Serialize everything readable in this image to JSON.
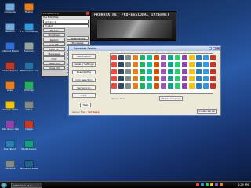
{
  "desktop_icons": [
    {
      "label": "Computer",
      "color": "#6fa8dc"
    },
    {
      "label": "Network",
      "color": "#6fa8dc"
    },
    {
      "label": "Internet Explorer",
      "color": "#2f6fd6"
    },
    {
      "label": "Adobe Reader 9",
      "color": "#c0392b"
    },
    {
      "label": "Avast",
      "color": "#e67e22"
    },
    {
      "label": "Hotmail 100%",
      "color": "#f1c40f"
    },
    {
      "label": "Dan Glove Calender",
      "color": "#8e44ad"
    },
    {
      "label": "EasyTouch",
      "color": "#2980b9"
    },
    {
      "label": "HD-Work",
      "color": "#7f8c8d"
    },
    {
      "label": "Firefox",
      "color": "#e67e22"
    },
    {
      "label": "FTP Photoshop",
      "color": "#3498db"
    },
    {
      "label": "Scanner",
      "color": "#95a5a6"
    },
    {
      "label": "HP Solution Center",
      "color": "#2471a3"
    },
    {
      "label": "Hotmail",
      "color": "#27ae60"
    },
    {
      "label": "Setup",
      "color": "#7f8c8d"
    },
    {
      "label": "Opera",
      "color": "#c0392b"
    },
    {
      "label": "Media Player",
      "color": "#16a085"
    },
    {
      "label": "Nokia PC Suite",
      "color": "#1f618d"
    }
  ],
  "prohack": {
    "title": "ProHack v1.0",
    "menu": "File  Edit  Help",
    "ip": "127.0.0.1",
    "language": "English",
    "buttons": [
      "PC Info",
      "Shutdown",
      "Restart",
      "Log Off",
      "Lock PC",
      "Messages",
      "Cmd",
      "Open CD",
      "Close CD",
      "Mouse",
      "Desktop",
      "Keyboard"
    ],
    "buttons2": [
      "Applications",
      "Processes",
      "Registry",
      "Files",
      "Screen",
      "Chat",
      "Folder",
      "Hack"
    ]
  },
  "banner": {
    "text": "PROHACK.NET PROFESSIONAL INTERNET"
  },
  "generator": {
    "title": "Generate Server",
    "side_buttons": [
      "Notification",
      "General Settings",
      "Execute/File",
      "Icon Selection",
      "Server Icon",
      "Save"
    ],
    "help": "Help",
    "server_icon_label": "Server Icon",
    "choose_label": "Choose Icon/icon",
    "create_label": "Create Server",
    "status_text": "Server Files :",
    "status_state": "Not Ready",
    "icon_colors": [
      "#e74c3c",
      "#3498db",
      "#f1c40f",
      "#2ecc71",
      "#9b59b6",
      "#1abc9c",
      "#e67e22",
      "#34495e",
      "#c0392b",
      "#2980b9",
      "#8e44ad",
      "#16a085",
      "#d35400",
      "#27ae60",
      "#7f8c8d"
    ]
  },
  "taskbar": {
    "item": "AI-Prohack v1.0",
    "clock": "4:29 PM",
    "tray_colors": [
      "#e74c3c",
      "#3498db",
      "#2ecc71",
      "#f1c40f",
      "#9b59b6",
      "#e67e22"
    ]
  }
}
